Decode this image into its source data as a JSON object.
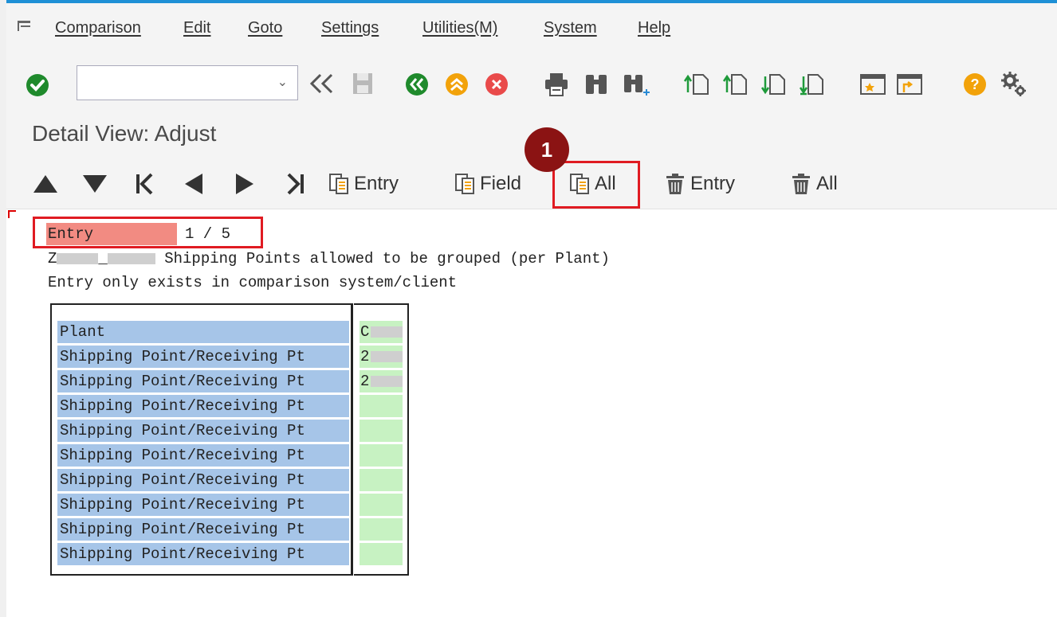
{
  "menu": {
    "items": [
      "Comparison",
      "Edit",
      "Goto",
      "Settings",
      "Utilities(M)",
      "System",
      "Help"
    ]
  },
  "toolbar": {
    "command_value": "",
    "icons": [
      "enter-icon",
      "history-back-icon",
      "save-icon",
      "back-icon",
      "exit-icon",
      "cancel-icon",
      "print-icon",
      "find-icon",
      "find-next-icon",
      "first-page-icon",
      "previous-page-icon",
      "next-page-icon",
      "last-page-icon",
      "create-session-icon",
      "shortcut-icon",
      "help-icon",
      "settings-icon"
    ]
  },
  "title": "Detail View: Adjust",
  "app_toolbar": {
    "copy_entry": "Entry",
    "copy_field": "Field",
    "copy_all": "All",
    "delete_entry": "Entry",
    "delete_all": "All"
  },
  "annotation": {
    "badge": "1",
    "color": "#8b1313"
  },
  "content": {
    "entry_label": "Entry",
    "entry_count": "1 / 5",
    "table_id_prefix": "Z",
    "table_desc": "Shipping Points allowed to be grouped (per Plant)",
    "status": "Entry only exists in comparison system/client",
    "rows": [
      {
        "label": "Plant",
        "value": "C"
      },
      {
        "label": "Shipping Point/Receiving Pt",
        "value": "2"
      },
      {
        "label": "Shipping Point/Receiving Pt",
        "value": "2"
      },
      {
        "label": "Shipping Point/Receiving Pt",
        "value": ""
      },
      {
        "label": "Shipping Point/Receiving Pt",
        "value": ""
      },
      {
        "label": "Shipping Point/Receiving Pt",
        "value": ""
      },
      {
        "label": "Shipping Point/Receiving Pt",
        "value": ""
      },
      {
        "label": "Shipping Point/Receiving Pt",
        "value": ""
      },
      {
        "label": "Shipping Point/Receiving Pt",
        "value": ""
      },
      {
        "label": "Shipping Point/Receiving Pt",
        "value": ""
      }
    ]
  },
  "colors": {
    "label_bg": "#a6c5e8",
    "value_bg": "#c7f2c2",
    "highlight": "#e01b22",
    "entry_bg": "#f28b82"
  }
}
